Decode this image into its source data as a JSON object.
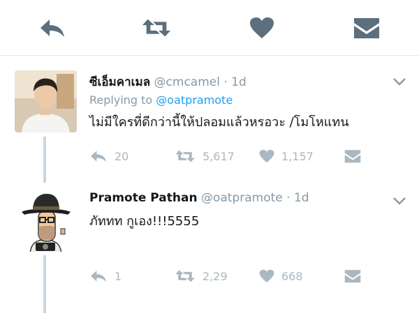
{
  "icons": {
    "top_reply": "reply-icon",
    "top_retweet": "retweet-icon",
    "top_like": "heart-icon",
    "top_dm": "envelope-icon",
    "caret": "chevron-down-icon"
  },
  "colors": {
    "icon_dark": "#5b6f7d",
    "icon_light": "#aab8c2",
    "link": "#1da1f2",
    "muted": "#8899a6"
  },
  "tweets": [
    {
      "name": "ซีเอ็มคาเมล",
      "handle": "@cmcamel",
      "separator": "·",
      "time": "1d",
      "reply_prefix": "Replying to",
      "reply_mention": "@oatpramote",
      "text": "ไม่มีใครที่ดีกว่านี้ให้ปลอมแล้วหรอวะ /โมโหแทน",
      "reply_count": "20",
      "retweet_count": "5,617",
      "like_count": "1,157"
    },
    {
      "name": "Pramote Pathan",
      "handle": "@oatpramote",
      "separator": "·",
      "time": "1d",
      "text": "ภัททท กูเอง!!!5555",
      "reply_count": "1",
      "retweet_count": "2,29",
      "like_count": "668"
    }
  ]
}
